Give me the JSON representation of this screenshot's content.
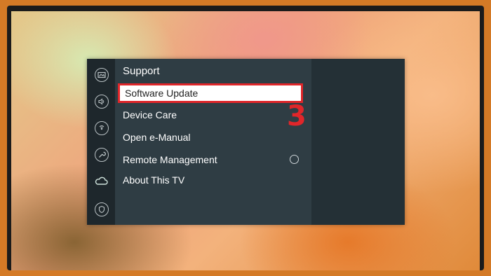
{
  "menu": {
    "title": "Support",
    "items": [
      {
        "label": "Software Update",
        "selected": true
      },
      {
        "label": "Device Care"
      },
      {
        "label": "Open e-Manual"
      },
      {
        "label": "Remote Management"
      },
      {
        "label": "About This TV"
      }
    ]
  },
  "sidebar_icons": [
    "picture-icon",
    "sound-icon",
    "broadcasting-icon",
    "general-wrench-icon",
    "support-cloud-icon",
    "privacy-shield-icon"
  ],
  "annotation": {
    "step": "3",
    "color": "#e0262a"
  },
  "colors": {
    "highlight_border": "#e0262a",
    "panel": "#2f3d44"
  }
}
